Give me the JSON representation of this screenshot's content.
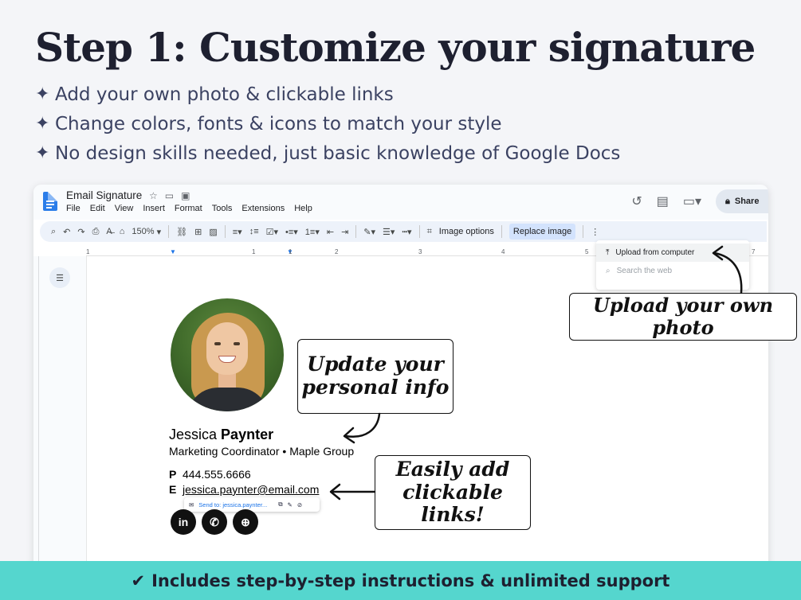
{
  "headline": "Step 1: Customize your signature",
  "bullets": [
    "Add your own photo & clickable links",
    "Change colors, fonts & icons to match your style",
    "No design skills needed, just basic knowledge of Google Docs"
  ],
  "bullet_icon": "sparkle-icon",
  "docs": {
    "title": "Email Signature",
    "menu": [
      "File",
      "Edit",
      "View",
      "Insert",
      "Format",
      "Tools",
      "Extensions",
      "Help"
    ],
    "share_label": "Share",
    "zoom": "150%",
    "image_options_label": "Image options",
    "replace_image_label": "Replace image",
    "ruler_ticks": [
      "1",
      "1",
      "1",
      "2",
      "3",
      "4",
      "5",
      "6",
      "7"
    ],
    "dropdown": {
      "upload": "Upload from computer",
      "search": "Search the web"
    }
  },
  "signature": {
    "first_name": "Jessica",
    "last_name": "Paynter",
    "role": "Marketing Coordinator • Maple Group",
    "phone_label": "P",
    "phone": "444.555.6666",
    "email_label": "E",
    "email": "jessica.paynter@email.com",
    "link_chip": "Send to: jessica.paynter...",
    "social": [
      "in",
      "whatsapp",
      "globe"
    ]
  },
  "callouts": {
    "upload": "Upload your own photo",
    "update_line1": "Update your",
    "update_line2": "personal info",
    "links_line1": "Easily add",
    "links_line2": "clickable links!"
  },
  "footer": "Includes step-by-step instructions & unlimited support",
  "colors": {
    "background": "#f4f5f8",
    "footer": "#55d6ce",
    "headline": "#1e2030",
    "docs_blue": "#2b7de9"
  }
}
